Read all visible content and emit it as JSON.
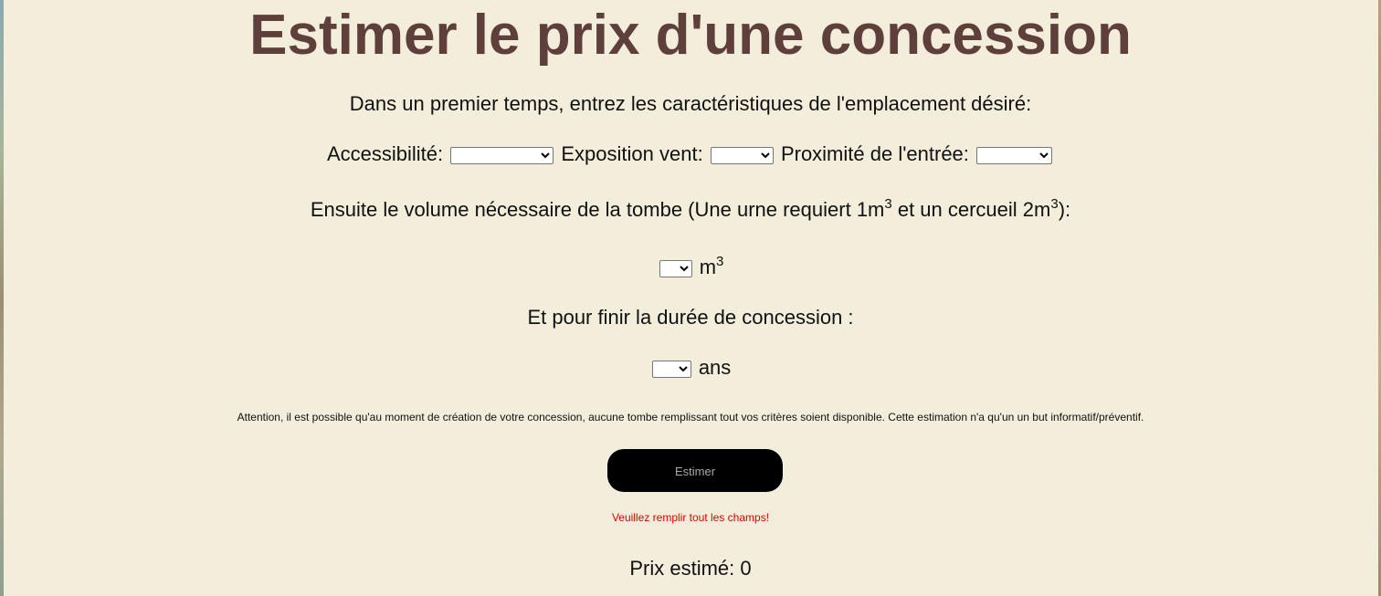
{
  "title": "Estimer le prix d'une concession",
  "intro": "Dans un premier temps, entrez les caractéristiques de l'emplacement désiré:",
  "fields": {
    "accessibilite_label": "Accessibilité:",
    "accessibilite_value": "",
    "exposition_label": "Exposition vent:",
    "exposition_value": "",
    "proximite_label": "Proximité de l'entrée:",
    "proximite_value": ""
  },
  "volume": {
    "text_before": "Ensuite le volume nécessaire de la tombe (Une urne requiert 1m",
    "exp1": "3",
    "text_middle": " et un cercueil 2m",
    "exp2": "3",
    "text_after": "):",
    "value": "",
    "unit": "m",
    "unit_exp": "3"
  },
  "duree": {
    "label": "Et pour finir la durée de concession :",
    "value": "",
    "unit": "ans"
  },
  "note": "Attention, il est possible qu'au moment de création de votre concession, aucune tombe remplissant tout vos critères soient disponible. Cette estimation n'a qu'un un but informatif/préventif.",
  "button_label": "Estimer",
  "error": "Veuillez remplir tout les champs!",
  "price": "Prix estimé: 0",
  "colors": {
    "background": "#f3eddb",
    "title": "#5f3f3b",
    "error": "#e00000",
    "button": "#000000"
  }
}
